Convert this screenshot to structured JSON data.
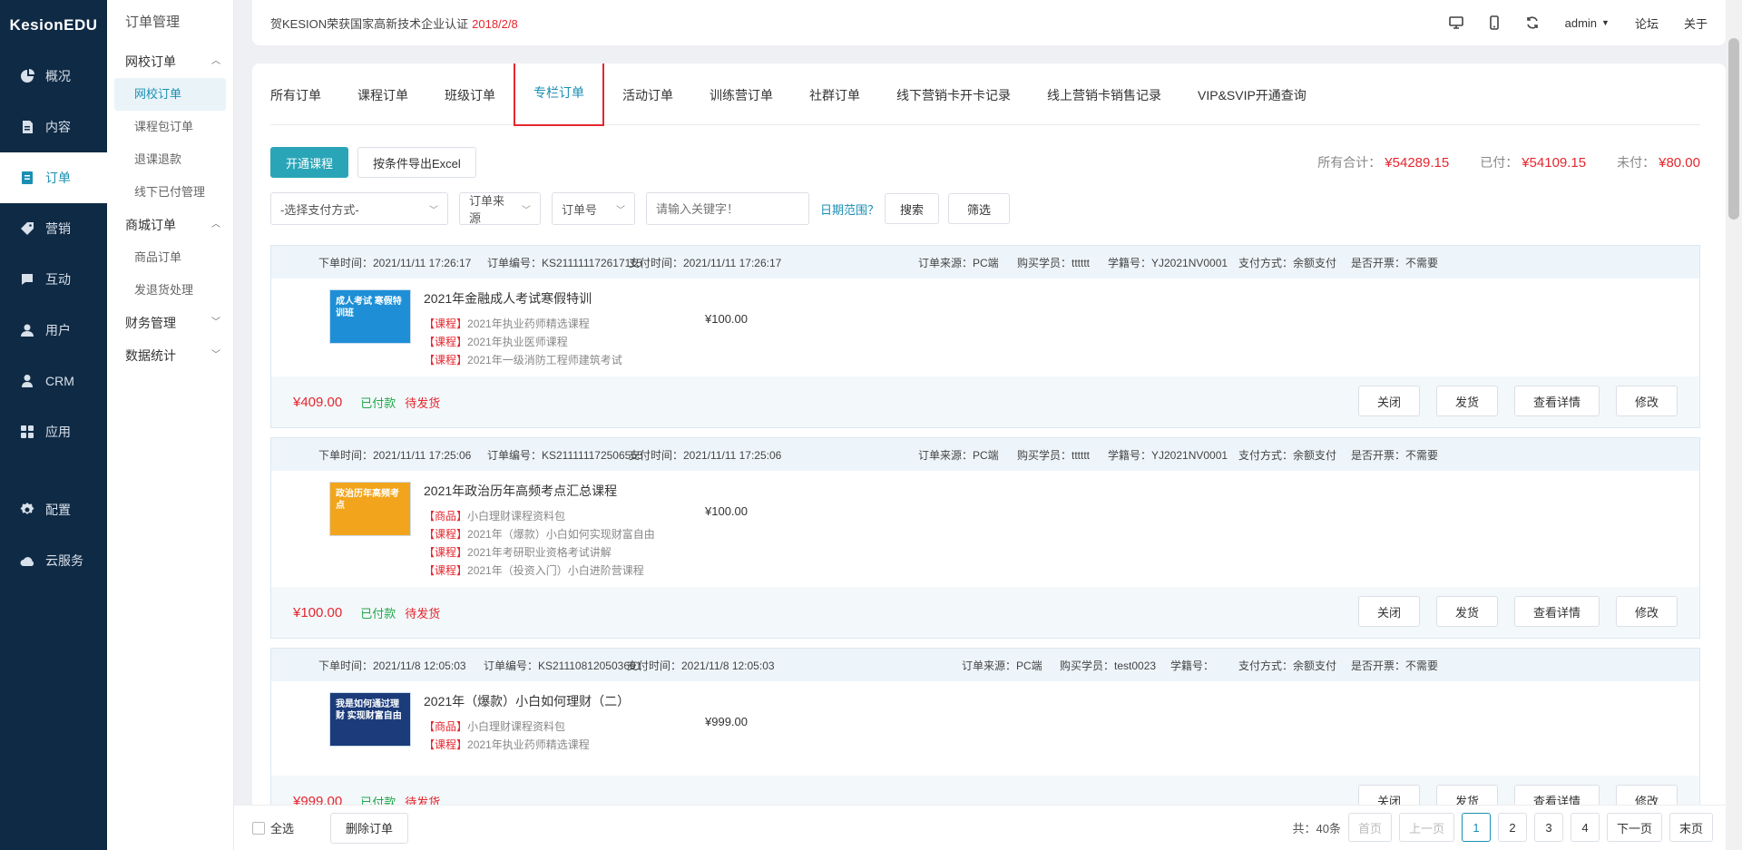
{
  "brand": "KesionEDU",
  "nav": [
    {
      "label": "概况",
      "icon": "pie-icon"
    },
    {
      "label": "内容",
      "icon": "document-icon"
    },
    {
      "label": "订单",
      "icon": "order-icon",
      "active": true
    },
    {
      "label": "营销",
      "icon": "tag-icon"
    },
    {
      "label": "互动",
      "icon": "chat-icon"
    },
    {
      "label": "用户",
      "icon": "user-icon"
    },
    {
      "label": "CRM",
      "icon": "person-icon"
    },
    {
      "label": "应用",
      "icon": "grid-icon"
    },
    {
      "label": "配置",
      "icon": "gear-icon"
    },
    {
      "label": "云服务",
      "icon": "cloud-icon"
    }
  ],
  "sub": {
    "title": "订单管理",
    "groups": [
      {
        "label": "网校订单",
        "chev": "^",
        "items": [
          "网校订单",
          "课程包订单",
          "退课退款",
          "线下已付管理"
        ]
      },
      {
        "label": "商城订单",
        "chev": "^",
        "items": [
          "商品订单",
          "发退货处理"
        ]
      },
      {
        "label": "财务管理",
        "chev": "v",
        "items": []
      },
      {
        "label": "数据统计",
        "chev": "v",
        "items": []
      }
    ]
  },
  "topbar": {
    "notice": "贺KESION荣获国家高新技术企业认证",
    "notice_date": "2018/2/8",
    "user": "admin",
    "forum": "论坛",
    "about": "关于"
  },
  "tabs": [
    "所有订单",
    "课程订单",
    "班级订单",
    "专栏订单",
    "活动订单",
    "训练营订单",
    "社群订单",
    "线下营销卡开卡记录",
    "线上营销卡销售记录",
    "VIP&SVIP开通查询"
  ],
  "toolbar": {
    "open_course": "开通课程",
    "export": "按条件导出Excel",
    "total_label": "所有合计：",
    "total": "¥54289.15",
    "paid_label": "已付：",
    "paid": "¥54109.15",
    "unpaid_label": "未付：",
    "unpaid": "¥80.00"
  },
  "filters": {
    "pay_method": "-选择支付方式-",
    "source": "订单来源",
    "order_no": "订单号",
    "keyword_placeholder": "请输入关键字！",
    "date_range": "日期范围？",
    "search": "搜索",
    "filter": "筛选"
  },
  "orders": [
    {
      "time": "下单时间：2021/11/11 17:26:17",
      "no": "订单编号：KS211111172617115",
      "paytime": "支付时间：2021/11/11 17:26:17",
      "source": "订单来源：PC端",
      "buyer": "购买学员：tttttt",
      "sid": "学籍号：YJ2021NV0001",
      "method": "支付方式：余额支付",
      "invoice": "是否开票：不需要",
      "title": "2021年金融成人考试寒假特训",
      "lines": [
        [
          "【课程】",
          "2021年执业药师精选课程"
        ],
        [
          "【课程】",
          "2021年执业医师课程"
        ],
        [
          "【课程】",
          "2021年一级消防工程师建筑考试"
        ]
      ],
      "price": "¥100.00",
      "amount": "¥409.00",
      "paid": "已付款",
      "ship": "待发货",
      "thumb_color": "#1e8fd6",
      "thumb_text": "成人考试 寒假特训班"
    },
    {
      "time": "下单时间：2021/11/11 17:25:06",
      "no": "订单编号：KS211111172506555",
      "paytime": "支付时间：2021/11/11 17:25:06",
      "source": "订单来源：PC端",
      "buyer": "购买学员：tttttt",
      "sid": "学籍号：YJ2021NV0001",
      "method": "支付方式：余额支付",
      "invoice": "是否开票：不需要",
      "title": "2021年政治历年高频考点汇总课程",
      "lines": [
        [
          "【商品】",
          "小白理财课程资料包"
        ],
        [
          "【课程】",
          "2021年（爆款）小白如何实现财富自由"
        ],
        [
          "【课程】",
          "2021年考研职业资格考试讲解"
        ],
        [
          "【课程】",
          "2021年（投资入门）小白进阶营课程"
        ]
      ],
      "price": "¥100.00",
      "amount": "¥100.00",
      "paid": "已付款",
      "ship": "待发货",
      "thumb_color": "#f2a51c",
      "thumb_text": "政治历年高频考点"
    },
    {
      "time": "下单时间：2021/11/8 12:05:03",
      "no": "订单编号：KS211108120503691",
      "paytime": "支付时间：2021/11/8 12:05:03",
      "source": "订单来源：PC端",
      "buyer": "购买学员：test0023",
      "sid": "学籍号：",
      "method": "支付方式：余额支付",
      "invoice": "是否开票：不需要",
      "title": "2021年（爆款）小白如何理财（二）",
      "lines": [
        [
          "【商品】",
          "小白理财课程资料包"
        ],
        [
          "【课程】",
          "2021年执业药师精选课程"
        ]
      ],
      "price": "¥999.00",
      "amount": "¥999.00",
      "paid": "已付款",
      "ship": "待发货",
      "thumb_color": "#1b3b7a",
      "thumb_text": "我是如何通过理财 实现财富自由"
    }
  ],
  "actions": {
    "close": "关闭",
    "ship": "发货",
    "detail": "查看详情",
    "edit": "修改"
  },
  "bottom": {
    "select_all": "全选",
    "delete": "删除订单",
    "total": "共：40条",
    "first": "首页",
    "prev": "上一页",
    "pages": [
      "1",
      "2",
      "3",
      "4"
    ],
    "next": "下一页",
    "last": "末页"
  }
}
